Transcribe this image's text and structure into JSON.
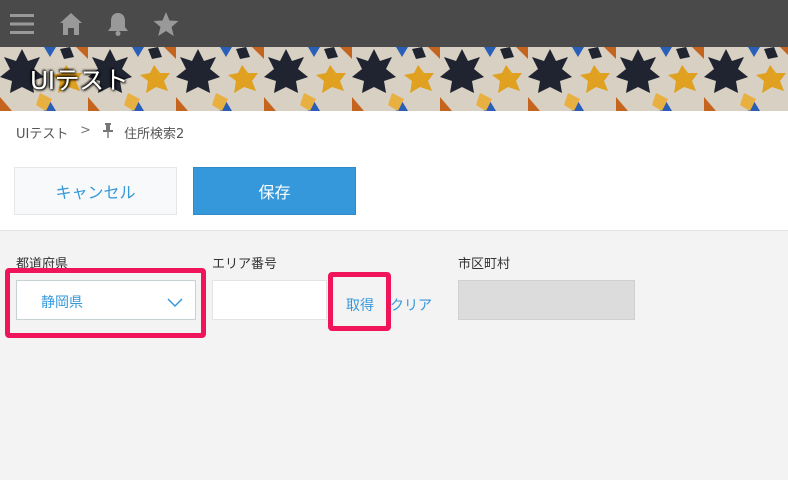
{
  "topbar": {
    "icons": [
      "menu-icon",
      "home-icon",
      "bell-icon",
      "star-icon"
    ]
  },
  "banner": {
    "title": "UIテスト"
  },
  "breadcrumb": {
    "app": "UIテスト",
    "separator": ">",
    "page": "住所検索2"
  },
  "actions": {
    "cancel_label": "キャンセル",
    "save_label": "保存"
  },
  "form": {
    "prefecture_label": "都道府県",
    "prefecture_value": "静岡県",
    "area_code_label": "エリア番号",
    "area_code_value": "",
    "get_label": "取得",
    "clear_label": "クリア",
    "city_label": "市区町村",
    "city_value": ""
  },
  "colors": {
    "topbar": "#4a4a4a",
    "accent": "#3498db",
    "highlight": "#f0145a",
    "background": "#f3f3f3"
  }
}
